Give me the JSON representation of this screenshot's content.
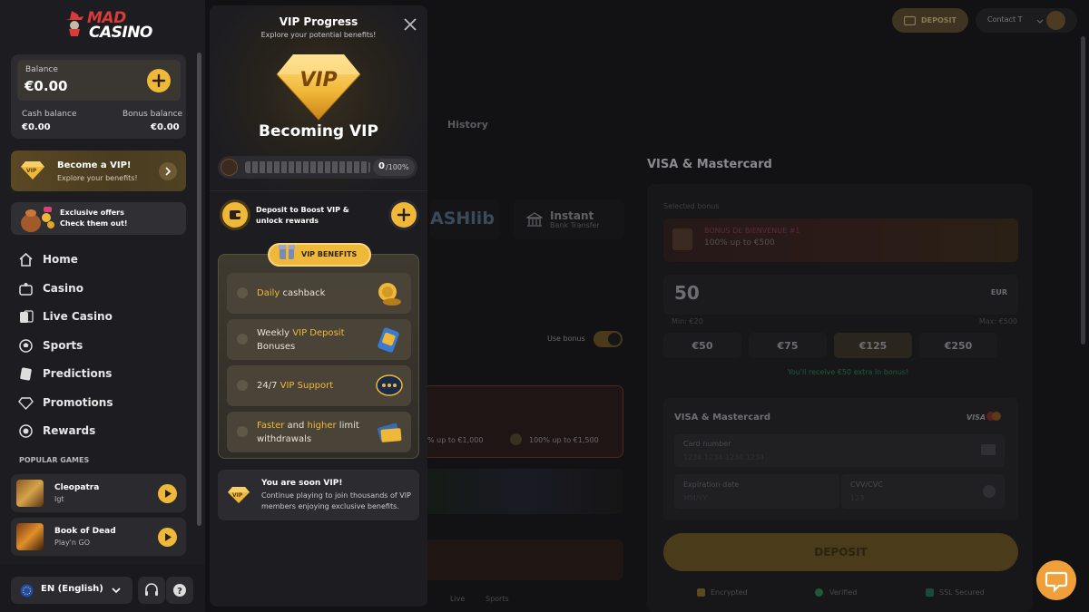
{
  "brand": {
    "logo_line1": "MAD",
    "logo_line2": "CASINO"
  },
  "balance": {
    "label": "Balance",
    "amount": "€0.00",
    "cash_label": "Cash balance",
    "cash_value": "€0.00",
    "bonus_label": "Bonus balance",
    "bonus_value": "€0.00"
  },
  "vip_card": {
    "title": "Become a VIP!",
    "subtitle": "Explore your benefits!",
    "badge": "VIP"
  },
  "offers_card": {
    "line1": "Exclusive offers",
    "line2": "Check them out!"
  },
  "nav": [
    {
      "label": "Home",
      "icon": "home-icon"
    },
    {
      "label": "Casino",
      "icon": "casino-icon"
    },
    {
      "label": "Live Casino",
      "icon": "cards-icon"
    },
    {
      "label": "Sports",
      "icon": "soccer-ball-icon"
    },
    {
      "label": "Predictions",
      "icon": "predictions-icon"
    },
    {
      "label": "Promotions",
      "icon": "diamond-icon"
    },
    {
      "label": "Rewards",
      "icon": "rewards-icon"
    }
  ],
  "popular": {
    "heading": "POPULAR GAMES",
    "games": [
      {
        "name": "Cleopatra",
        "provider": "Igt"
      },
      {
        "name": "Book of Dead",
        "provider": "Play'n GO"
      }
    ]
  },
  "footer": {
    "language": "EN (English)"
  },
  "header": {
    "deposit_label": "DEPOSIT",
    "account_label": "Contact T"
  },
  "main": {
    "history_tab": "History",
    "method_title": "VISA & Mastercard",
    "instant_label": "Instant",
    "instant_sub": "Bank Transfer",
    "cashlib_label": "ASHlib",
    "selected_bonus_label": "Selected bonus",
    "bonus_name": "BONUS DE BIENVENUE #1",
    "bonus_desc": "100% up to €500",
    "amount": "50",
    "currency": "EUR",
    "min_label": "Min: €20",
    "max_label": "Max: €500",
    "presets": [
      "€50",
      "€75",
      "€125",
      "€250"
    ],
    "extra_note": "You'll receive €50 extra in bonus!",
    "card_section_title": "VISA & Mastercard",
    "visa_label": "VISA",
    "card_number_label": "Card number",
    "card_number_placeholder": "1234 1234 1234 1234",
    "expiration_label": "Expiration date",
    "expiration_placeholder": "MM/YY",
    "cvv_label": "CVV/CVC",
    "cvv_placeholder": "123",
    "deposit_button": "DEPOSIT",
    "trust": [
      "Encrypted",
      "Verified",
      "SSL Secured"
    ],
    "use_bonus_label": "Use bonus",
    "bonus_tile_1": "% up to €1,000",
    "bonus_tile_2": "100% up to €1,500",
    "filter_live": "Live",
    "filter_sports": "Sports"
  },
  "modal": {
    "title": "VIP Progress",
    "subtitle": "Explore your potential benefits!",
    "badge": "VIP",
    "heading": "Becoming VIP",
    "progress_value": "0",
    "progress_total": "/100%",
    "progress_fraction": 0,
    "boost_text": "Deposit to Boost VIP & unlock rewards",
    "benefits_label": "VIP BENEFITS",
    "benefits": [
      {
        "pre": "",
        "gold": "Daily",
        "post": " cashback",
        "line2": "",
        "icon": "coins-icon"
      },
      {
        "pre": "Weekly ",
        "gold": "VIP Deposit",
        "post": "",
        "line2": "Bonuses",
        "icon": "wallet-icon"
      },
      {
        "pre": "24/7 ",
        "gold": "VIP Support",
        "post": "",
        "line2": "",
        "icon": "chat-bubble-icon"
      },
      {
        "pre": "",
        "gold": "Faster",
        "post": " and ",
        "gold2": "higher",
        "post2": " limit",
        "line2": "withdrawals",
        "icon": "cash-icon"
      }
    ],
    "soon_title": "You are soon VIP!",
    "soon_text": "Continue playing to join thousands of VIP members enjoying exclusive benefits.",
    "soon_badge": "VIP"
  },
  "colors": {
    "accent": "#f0b839",
    "sidebar_bg": "#1d1d21",
    "page_bg": "#121214",
    "green": "#2ec27e"
  }
}
